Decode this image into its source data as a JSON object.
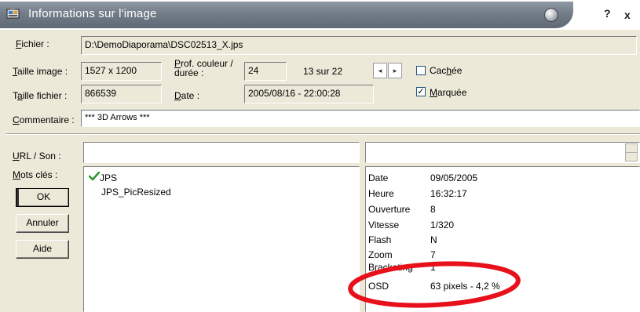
{
  "window": {
    "title": "Informations sur l'image",
    "help_label": "?",
    "close_label": "x"
  },
  "file": {
    "label_prefix": "F",
    "label_rest": "ichier :",
    "value": "D:\\DemoDiaporama\\DSC02513_X.jps"
  },
  "image_size": {
    "label_prefix": "T",
    "label_rest": "aille image :",
    "value": "1527 x 1200"
  },
  "depth": {
    "label_line1_prefix": "P",
    "label_line1_rest": "rof. couleur /",
    "label_line2": "durée :",
    "value": "24"
  },
  "position": {
    "text": "13  sur 22",
    "prev": "◂",
    "next": "▸"
  },
  "hidden": {
    "label_pre": "Cac",
    "label_ul": "h",
    "label_post": "ée",
    "checked": false
  },
  "file_size": {
    "label_pre": "T",
    "label_ul": "a",
    "label_post": "ille fichier :",
    "value": "866539"
  },
  "date": {
    "label_prefix": "D",
    "label_rest": "ate :",
    "value": "2005/08/16 - 22:00:28"
  },
  "marked": {
    "label_ul": "M",
    "label_rest": "arquée",
    "checked": true,
    "check_mark": "✓"
  },
  "comment": {
    "label_prefix": "C",
    "label_rest": "ommentaire :",
    "value": "*** 3D Arrows ***"
  },
  "url": {
    "label_prefix": "U",
    "label_rest": "RL / Son :",
    "value": ""
  },
  "keywords": {
    "label_prefix": "M",
    "label_rest": "ots clés :",
    "items": [
      {
        "label": "JPS",
        "checked": true
      },
      {
        "label": "JPS_PicResized",
        "checked": false
      }
    ]
  },
  "buttons": {
    "ok": "OK",
    "cancel": "Annuler",
    "help": "Aide"
  },
  "exif": [
    {
      "key": "Date",
      "value": "09/05/2005"
    },
    {
      "key": "Heure",
      "value": "16:32:17"
    },
    {
      "key": "Ouverture",
      "value": "8"
    },
    {
      "key": "Vitesse",
      "value": "1/320"
    },
    {
      "key": "Flash",
      "value": "N"
    },
    {
      "key": "Zoom",
      "value": "7"
    },
    {
      "key": "Bracketing",
      "value": "1"
    },
    {
      "key": "OSD",
      "value": "63 pixels - 4,2 %"
    }
  ],
  "annotation": {
    "color": "#e8101a",
    "highlights": "OSD"
  },
  "colors": {
    "titlebar": "#737d89",
    "panel": "#ece9d8",
    "check_green": "#2e9a2e"
  }
}
